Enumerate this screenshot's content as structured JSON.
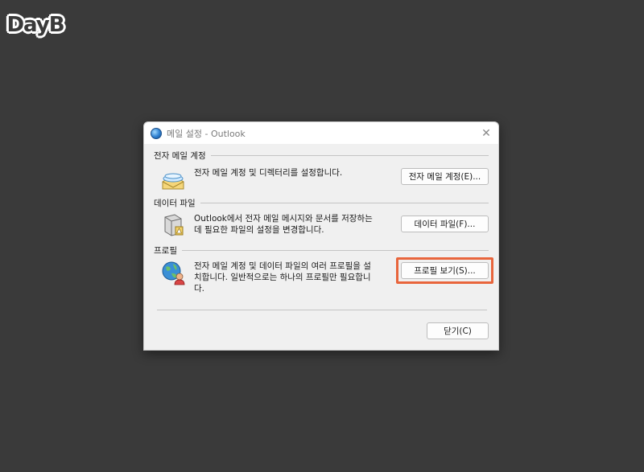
{
  "logo": {
    "text": "DayB"
  },
  "window": {
    "title": "메일 설정 - Outlook",
    "close_glyph": "✕"
  },
  "sections": {
    "email": {
      "header": "전자 메일 계정",
      "description": "전자 메일 계정 및 디렉터리를 설정합니다.",
      "button": "전자 메일 계정(E)...",
      "icon": "email-accounts-icon"
    },
    "data_files": {
      "header": "데이터 파일",
      "description_line1": "Outlook에서 전자 메일 메시지와 문서를 저장하는",
      "description_line2": "데 필요한 파일의 설정을 변경합니다.",
      "button": "데이터 파일(F)...",
      "icon": "data-files-icon"
    },
    "profiles": {
      "header": "프로필",
      "description_line1": "전자 메일 계정 및 데이터 파일의 여러 프로필을 설",
      "description_line2": "치합니다. 일반적으로는 하나의 프로필만 필요합니",
      "description_line3": "다.",
      "button": "프로필 보기(S)...",
      "icon": "profiles-icon",
      "highlight_color": "#e8653c"
    }
  },
  "footer": {
    "close_button": "닫기(C)"
  }
}
